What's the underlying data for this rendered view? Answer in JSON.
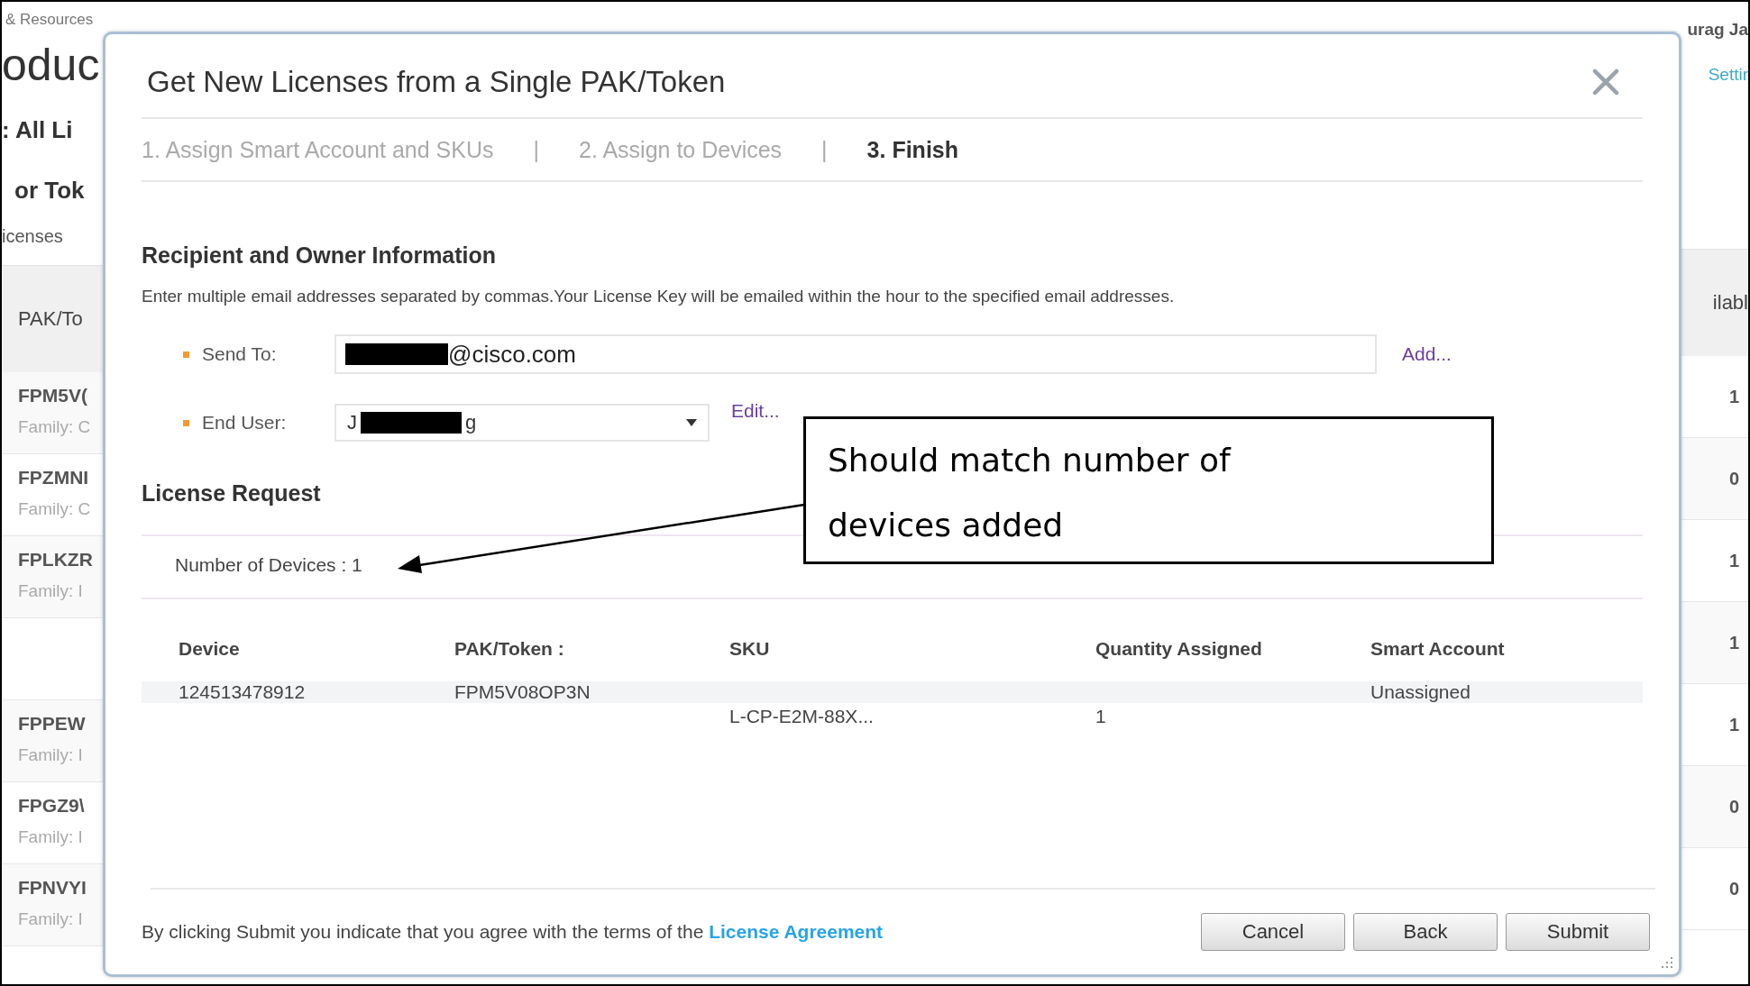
{
  "background": {
    "top_left": "& Resources",
    "heading": "oduc",
    "filter": ": All Li",
    "subheading": "or Tok",
    "dropdown": "icenses",
    "user": "urag Ja",
    "settings": "Settir",
    "column_left": "PAK/To",
    "column_right": "ilabl",
    "rows": [
      {
        "code": "FPM5V(",
        "family": "Family: C",
        "available": "1"
      },
      {
        "code": "FPZMNI",
        "family": "Family: C",
        "available": "0"
      },
      {
        "code": "FPLKZR",
        "family": "Family: I",
        "available": "1"
      },
      {
        "available": "1"
      },
      {
        "code": "FPPEW",
        "family": "Family: I",
        "available": "1"
      },
      {
        "code": "FPGZ9\\",
        "family": "Family: I",
        "available": "0"
      },
      {
        "code": "FPNVYI",
        "family": "Family: I",
        "available": "0"
      }
    ]
  },
  "dialog": {
    "title": "Get New Licenses from a Single PAK/Token",
    "steps": [
      {
        "label": "1. Assign Smart Account and SKUs",
        "selected": false
      },
      {
        "label": "2. Assign to Devices",
        "selected": false
      },
      {
        "label": "3. Finish",
        "selected": true
      }
    ],
    "step_separators": [
      "|",
      "|"
    ],
    "recipient_heading": "Recipient and Owner Information",
    "recipient_note": "Enter multiple email addresses separated by commas.Your License Key will be emailed within the hour to the specified email addresses.",
    "send_to": {
      "label": "Send To:",
      "required": true,
      "value": "@cisco.com",
      "link": "Add..."
    },
    "end_user": {
      "label": "End User:",
      "required": true,
      "value_start": "J",
      "value_end": "g",
      "link": "Edit..."
    },
    "license_heading": "License Request",
    "device_count": "Number of Devices : 1",
    "table": {
      "columns": [
        "Device",
        "PAK/Token :",
        "SKU",
        "Quantity Assigned",
        "Smart Account"
      ],
      "rows": [
        {
          "device": "124513478912",
          "pak": "FPM5V08OP3N",
          "sku": "L-CP-E2M-88X...",
          "quantity": "1",
          "account": "Unassigned"
        }
      ]
    },
    "footer_text": "By clicking Submit you indicate that you agree with the terms of the ",
    "footer_link": "License Agreement",
    "buttons": [
      "Cancel",
      "Back",
      "Submit"
    ]
  },
  "callout": {
    "text": "Should match number of devices added"
  }
}
